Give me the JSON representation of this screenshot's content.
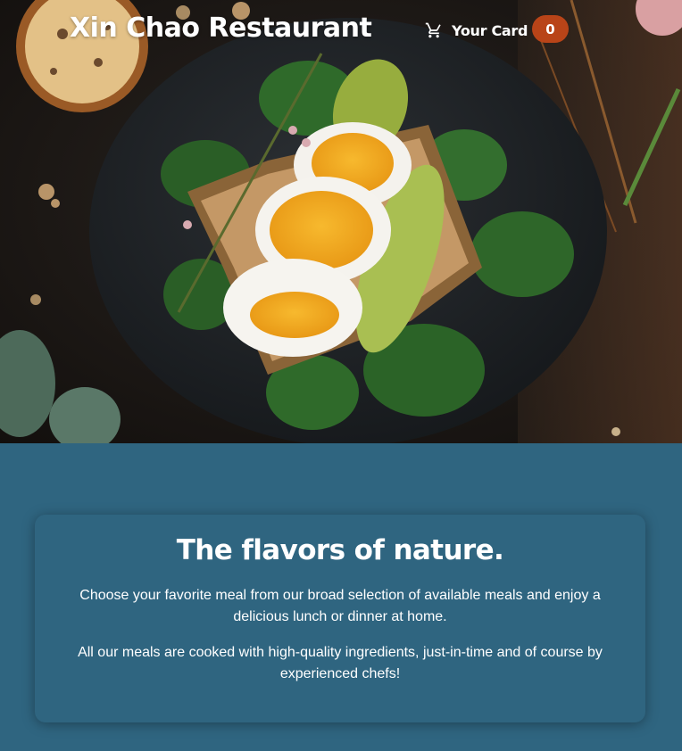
{
  "header": {
    "brand": "Xin Chao Restaurant",
    "cart_label": "Your Card",
    "cart_count": "0",
    "cart_icon": "shopping-cart-icon"
  },
  "hero": {
    "image": "breakfast-toast-eggs-avocado-spinach"
  },
  "summary": {
    "title": "The flavors of nature.",
    "paragraph_1": "Choose your favorite meal from our broad selection of available meals and enjoy a delicious lunch or dinner at home.",
    "paragraph_2": "All our meals are cooked with high-quality ingredients, just-in-time and of course by experienced chefs!"
  },
  "colors": {
    "page_background": "#2f6580",
    "badge": "#b94418",
    "text": "#ffffff"
  }
}
